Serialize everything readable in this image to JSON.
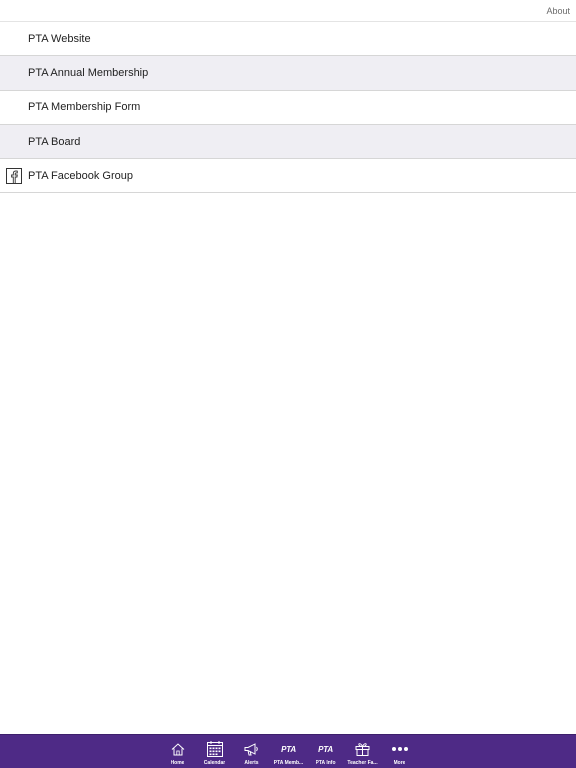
{
  "topbar": {
    "about_label": "About"
  },
  "list": {
    "items": [
      {
        "label": "PTA Website"
      },
      {
        "label": "PTA Annual Membership"
      },
      {
        "label": "PTA Membership Form"
      },
      {
        "label": "PTA Board"
      },
      {
        "label": "PTA Facebook Group",
        "icon": "facebook-icon"
      }
    ]
  },
  "tabbar": {
    "tabs": [
      {
        "label": "Home",
        "icon": "home-icon"
      },
      {
        "label": "Calendar",
        "icon": "calendar-icon"
      },
      {
        "label": "Alerts",
        "icon": "megaphone-icon"
      },
      {
        "label": "PTA Memb...",
        "icon": "pta-icon",
        "icon_text": "PTA"
      },
      {
        "label": "PTA Info",
        "icon": "pta-icon",
        "icon_text": "PTA"
      },
      {
        "label": "Teacher Fa...",
        "icon": "gift-icon"
      },
      {
        "label": "More",
        "icon": "more-icon"
      }
    ]
  },
  "colors": {
    "tabbar_bg": "#4e2a86",
    "row_alt_bg": "#efeef3",
    "text": "#222222"
  }
}
